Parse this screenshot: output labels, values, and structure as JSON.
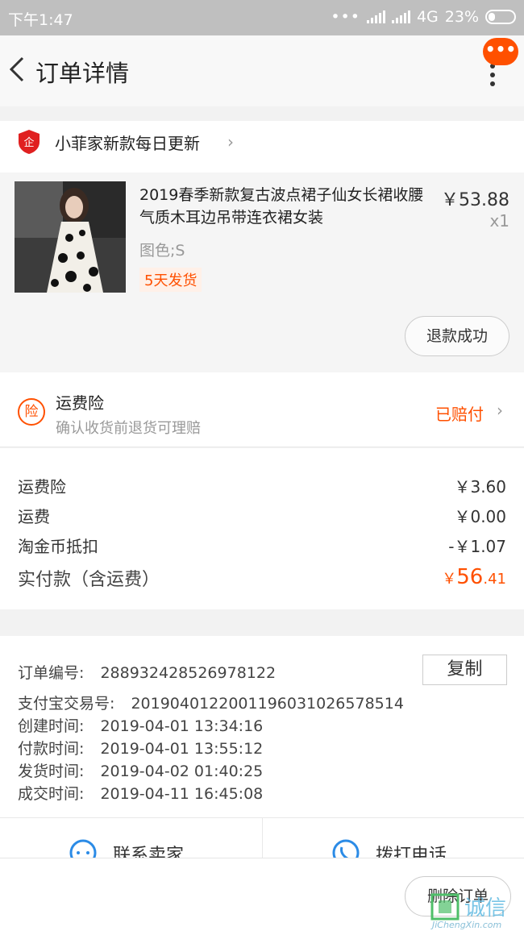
{
  "status_bar": {
    "time": "下午1:47",
    "network": "4G",
    "battery": "23%"
  },
  "nav": {
    "title": "订单详情",
    "more_badge": "•••"
  },
  "shop": {
    "name": "小菲家新款每日更新",
    "logo_text": "企"
  },
  "product": {
    "title": "2019春季新款复古波点裙子仙女长裙收腰气质木耳边吊带连衣裙女装",
    "price": "￥53.88",
    "quantity": "x1",
    "sku": "图色;S",
    "shipping_tag": "5天发货",
    "refund_status": "退款成功"
  },
  "insurance": {
    "icon_text": "险",
    "title": "运费险",
    "subtitle": "确认收货前退货可理赔",
    "status": "已赔付"
  },
  "fees": {
    "rows": [
      {
        "label": "运费险",
        "value": "￥3.60"
      },
      {
        "label": "运费",
        "value": "￥0.00"
      },
      {
        "label": "淘金币抵扣",
        "value": "-￥1.07"
      }
    ],
    "total_label": "实付款（含运费）",
    "total_currency": "￥",
    "total_integer": "56",
    "total_decimal": ".41"
  },
  "order_info": {
    "order_no_label": "订单编号:",
    "order_no": "288932428526978122",
    "copy_label": "复制",
    "alipay_label": "支付宝交易号:",
    "alipay_no": "2019040122001196031026578514",
    "created_label": "创建时间:",
    "created": "2019-04-01 13:34:16",
    "paid_label": "付款时间:",
    "paid": "2019-04-01 13:55:12",
    "shipped_label": "发货时间:",
    "shipped": "2019-04-02 01:40:25",
    "completed_label": "成交时间:",
    "completed": "2019-04-11 16:45:08"
  },
  "contact": {
    "seller_label": "联系卖家",
    "call_label": "拨打电话"
  },
  "bottom": {
    "delete_label": "删除订单"
  },
  "watermark": {
    "name": "诚信",
    "url": "JiChengXin.com"
  },
  "colors": {
    "accent": "#ff5000",
    "status_bar": "#bfbfbf",
    "link_blue": "#2b8be6"
  }
}
